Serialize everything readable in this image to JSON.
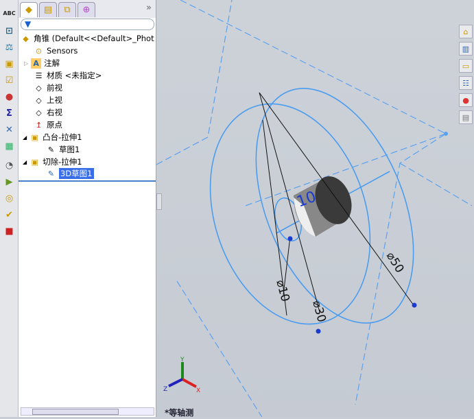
{
  "tree": {
    "root": "角锥   (Default<<Default>_Phot",
    "items": [
      {
        "label": "Sensors",
        "icon": "sensors-icon"
      },
      {
        "label": "注解",
        "icon": "annotations-icon"
      },
      {
        "label": "材质 <未指定>",
        "icon": "material-icon"
      },
      {
        "label": "前视",
        "icon": "plane-icon"
      },
      {
        "label": "上视",
        "icon": "plane-icon"
      },
      {
        "label": "右视",
        "icon": "plane-icon"
      },
      {
        "label": "原点",
        "icon": "origin-icon"
      },
      {
        "label": "凸台-拉伸1",
        "icon": "boss-extrude-icon"
      },
      {
        "label": "草图1",
        "icon": "sketch-icon"
      },
      {
        "label": "切除-拉伸1",
        "icon": "cut-extrude-icon"
      },
      {
        "label": "3D草图1",
        "icon": "3d-sketch-icon"
      }
    ]
  },
  "panel": {
    "expand": "»"
  },
  "viewport": {
    "view_name": "*等轴测",
    "dims": {
      "d1": "10",
      "d2": "⌀10",
      "d3": "⌀30",
      "d4": "⌀50"
    },
    "axes": {
      "x": "X",
      "y": "Y",
      "z": "Z"
    }
  },
  "colors": {
    "sketch": "#4a9cf0",
    "selection": "#3a6ee8"
  }
}
